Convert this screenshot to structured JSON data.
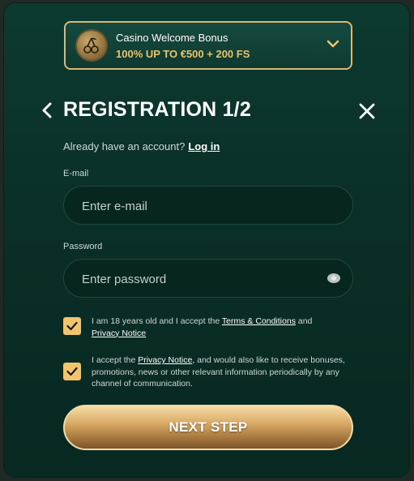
{
  "bonus": {
    "title": "Casino Welcome Bonus",
    "offer": "100% UP TO €500 + 200 FS",
    "badge_icon": "cherry-icon",
    "accent_color": "#e9c46a"
  },
  "header": {
    "title": "REGISTRATION 1/2"
  },
  "account": {
    "prompt": "Already have an account?",
    "login_label": "Log in"
  },
  "email": {
    "label": "E-mail",
    "placeholder": "Enter e-mail",
    "value": ""
  },
  "password": {
    "label": "Password",
    "placeholder": "Enter password",
    "value": ""
  },
  "consent_age": {
    "checked": true,
    "text_before": "I am 18 years old and I accept the ",
    "terms_link": "Terms & Conditions",
    "text_mid": " and ",
    "privacy_link": "Privacy Notice"
  },
  "consent_marketing": {
    "checked": true,
    "text_before": "I accept the ",
    "privacy_link": "Privacy Notice",
    "text_after": ", and would also like to receive bonuses, promotions, news or other relevant information periodically by any channel of communication."
  },
  "next_button": {
    "label": "NEXT STEP"
  }
}
